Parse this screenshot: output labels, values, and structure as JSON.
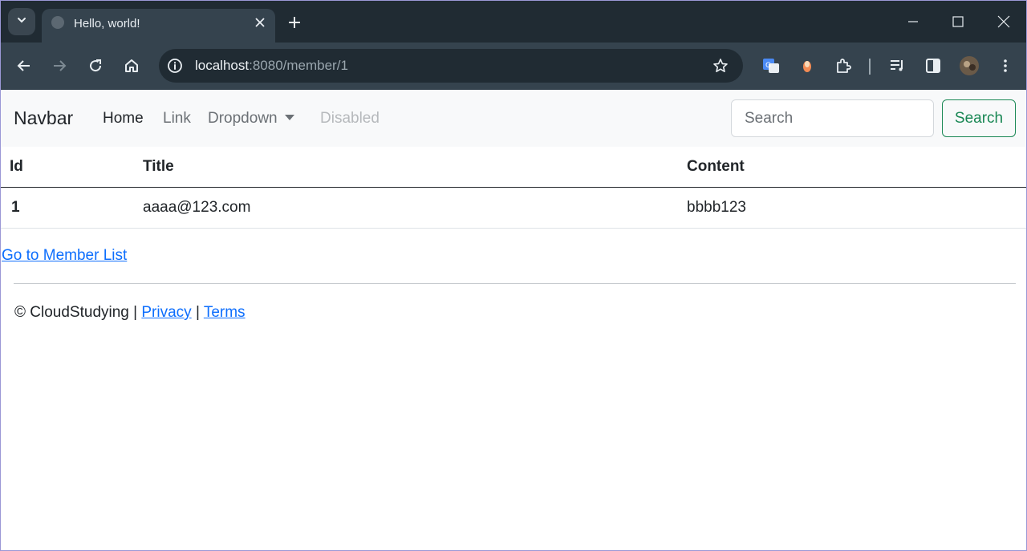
{
  "browser": {
    "tab_title": "Hello, world!",
    "url_host": "localhost",
    "url_rest": ":8080/member/1"
  },
  "icons": {
    "tab_search": "chevron-down-icon",
    "favicon": "globe-icon",
    "tab_close": "close-icon",
    "new_tab": "plus-icon",
    "minimize": "minimize-icon",
    "maximize": "maximize-icon",
    "close_window": "close-icon",
    "back": "arrow-left-icon",
    "forward": "arrow-right-icon",
    "reload": "reload-icon",
    "home": "home-icon",
    "site_info": "info-icon",
    "bookmark": "star-icon",
    "translate": "translate-icon",
    "extension_1": "extension-icon",
    "extensions": "puzzle-icon",
    "media": "playlist-icon",
    "side_panel": "side-panel-icon",
    "profile": "avatar",
    "menu": "more-vertical-icon"
  },
  "navbar": {
    "brand": "Navbar",
    "links": [
      "Home",
      "Link",
      "Dropdown",
      "Disabled"
    ],
    "search_placeholder": "Search",
    "search_button": "Search"
  },
  "table": {
    "headers": [
      "Id",
      "Title",
      "Content"
    ],
    "rows": [
      [
        "1",
        "aaaa@123.com",
        "bbbb123"
      ]
    ]
  },
  "links": {
    "member_list": "Go to Member List"
  },
  "footer": {
    "copyright": "© CloudStudying",
    "separator": "|",
    "privacy": "Privacy",
    "terms": "Terms"
  },
  "colors": {
    "tabstrip": "#202b33",
    "toolbar": "#35434e",
    "navbar_bg": "#f8f9fa",
    "link": "#0d6efd",
    "success": "#198754"
  }
}
